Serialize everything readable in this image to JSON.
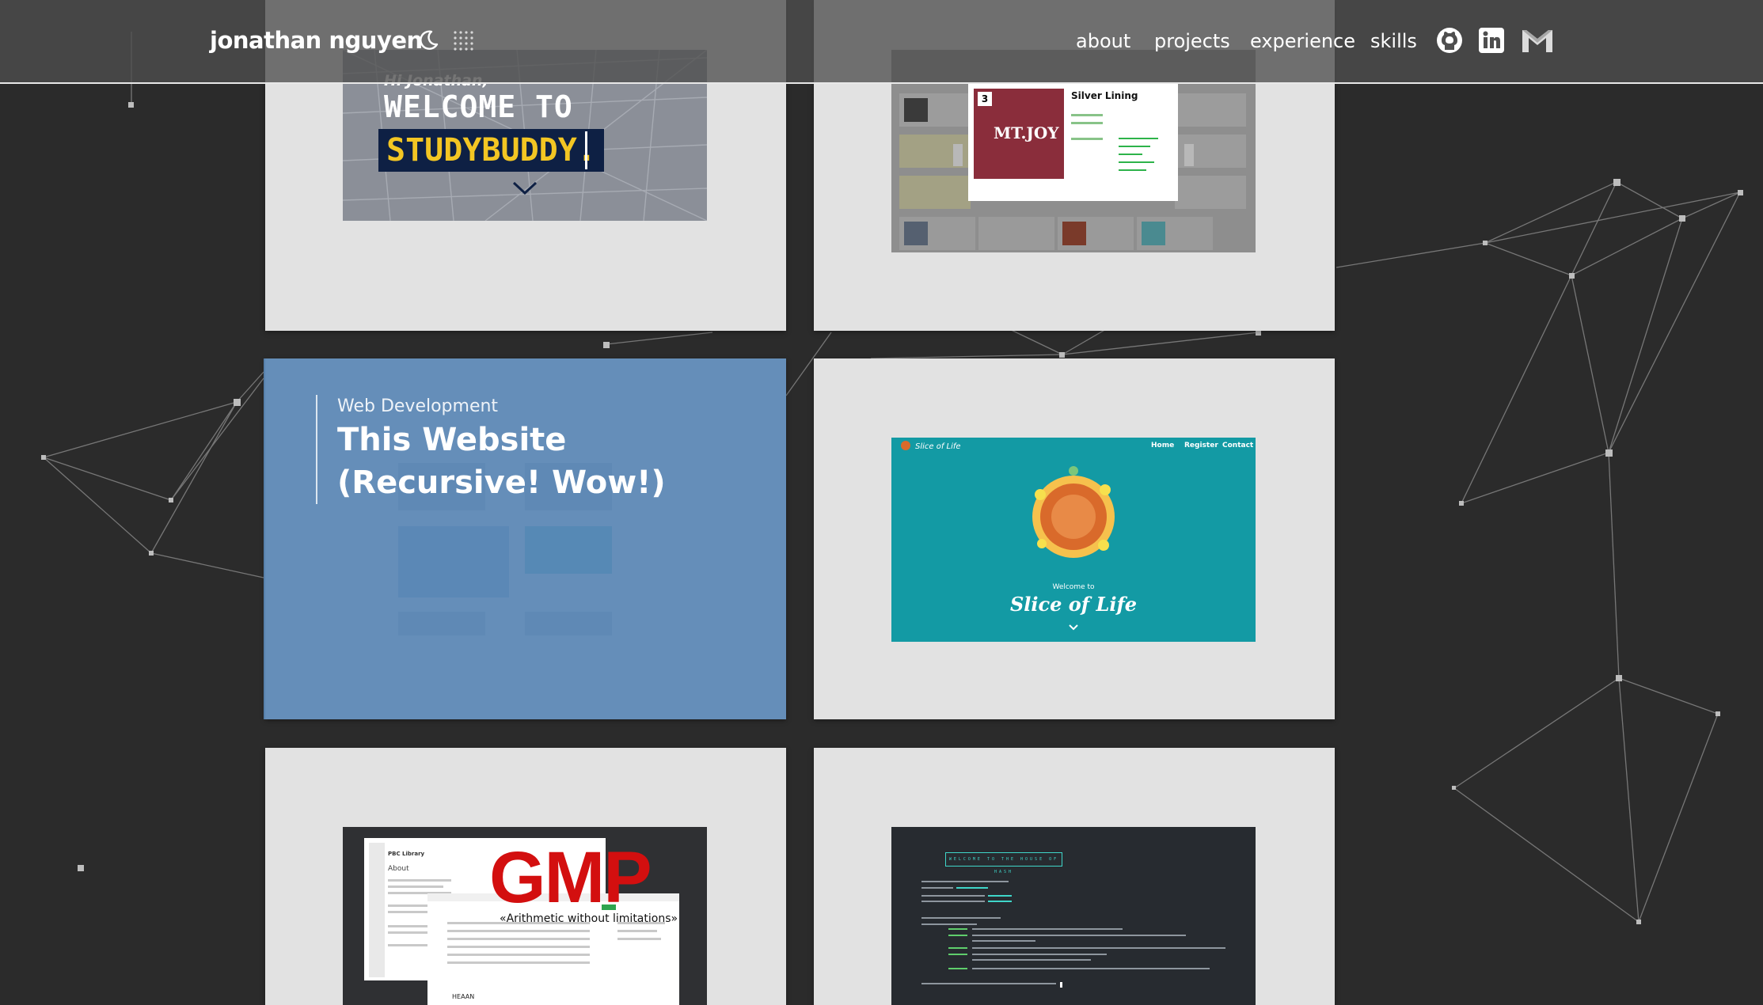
{
  "header": {
    "brand": "jonathan nguyen",
    "nav": [
      "about",
      "projects",
      "experience",
      "skills"
    ],
    "social": [
      "github-icon",
      "linkedin-icon",
      "gmail-icon"
    ]
  },
  "projects": {
    "studybuddy": {
      "greeting": "Hi Jonathan,",
      "welcome": "WELCOME TO",
      "name": "STUDYBUDDY."
    },
    "music": {
      "rank": "3",
      "album_text": "MT.JOY",
      "track_title": "Silver Lining"
    },
    "website": {
      "category": "Web Development",
      "title": "This Website (Recursive! Wow!)"
    },
    "slice_of_life": {
      "brand": "Slice of Life",
      "nav": [
        "Home",
        "Register",
        "Contact"
      ],
      "welcome": "Welcome to",
      "title": "Slice of Life"
    },
    "gmp": {
      "logo": "GMP",
      "tagline": "«Arithmetic without limitations»",
      "doc_title": "PBC Library",
      "doc_heading": "About",
      "footer": "HEAAN"
    },
    "hash": {
      "banner": "WELCOME TO THE HOUSE OF HASH"
    }
  },
  "colors": {
    "background": "#2b2b2b",
    "card": "#e2e2e2",
    "header": "#4e4e4e",
    "overlay": "#5b88b6",
    "teal": "#139aa4",
    "gmp_red": "#d30f0f",
    "studybuddy_gold": "#f3c623",
    "studybuddy_navy": "#0e2044"
  }
}
